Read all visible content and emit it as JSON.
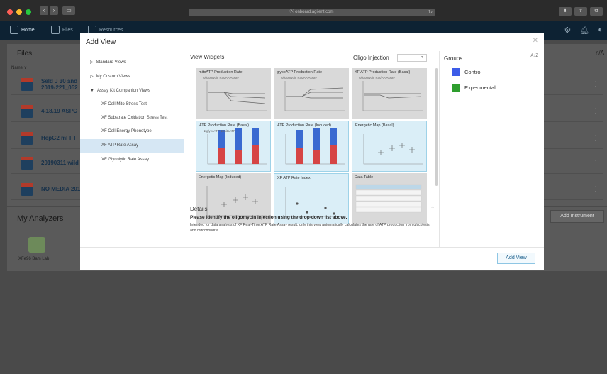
{
  "browser": {
    "url": "Ⓐ onboard.agilent.com",
    "back": "‹",
    "forward": "›",
    "reload": "↻"
  },
  "app_nav": {
    "tabs": [
      {
        "label": "Home",
        "icon": "home-icon"
      },
      {
        "label": "Files",
        "icon": "files-icon"
      },
      {
        "label": "Resources",
        "icon": "resources-icon"
      }
    ]
  },
  "files_panel": {
    "title": "Files",
    "name_header": "Name ∨",
    "rows": [
      {
        "name": "Seld J 30 and\n2019-221_052"
      },
      {
        "name": "4.18.19 ASPC"
      },
      {
        "name": "HepG2 mFFT"
      },
      {
        "name": "20190311 wild"
      },
      {
        "name": "NO MEDIA 201"
      }
    ]
  },
  "analyzers": {
    "title": "My Analyzers",
    "add_button": "Add Instrument",
    "device_label": "XFe96 Bam Lab"
  },
  "modal": {
    "title": "Add View",
    "close": "✕",
    "tree": [
      {
        "label": "Standard Views",
        "expanded": false
      },
      {
        "label": "My Custom Views",
        "expanded": false
      },
      {
        "label": "Assay Kit Companion Views",
        "expanded": true
      }
    ],
    "subitems": [
      "XF Cell Mito Stress Test",
      "XF Substrate Oxidation Stress Test",
      "XF Cell Energy Phenotype",
      "XF ATP Rate Assay",
      "XF Glycolytic Rate Assay"
    ],
    "selected_subitem_index": 3,
    "widgets_title": "View Widgets",
    "oligo_label": "Oligo Injection",
    "oligo_value": "▾",
    "widgets": [
      {
        "title": "mitoATP Production Rate",
        "legend": "Oligomycin  Rot/AA  Assay",
        "kind": "lines-down",
        "selected": false
      },
      {
        "title": "glycoATP Production Rate",
        "legend": "Oligomycin  Rot/AA  Assay",
        "kind": "lines-up",
        "selected": false
      },
      {
        "title": "XF ATP Production Rate (Basal)",
        "legend": "Oligomycin  Rot/AA  Assay",
        "kind": "lines-flat",
        "selected": false
      },
      {
        "title": "ATP Production Rate (Basal)",
        "legend": "■ glycoATP  ■ mitoATP",
        "kind": "bars",
        "selected": true
      },
      {
        "title": "ATP Production Rate (Induced)",
        "legend": "",
        "kind": "bars",
        "selected": true
      },
      {
        "title": "Energetic Map (Basal)",
        "legend": "",
        "kind": "scatter",
        "selected": true
      },
      {
        "title": "Energetic Map (Induced)",
        "legend": "",
        "kind": "scatter",
        "selected": false
      },
      {
        "title": "XF ATP Rate Index",
        "legend": "",
        "kind": "index",
        "selected": true
      },
      {
        "title": "Data Table",
        "legend": "",
        "kind": "table",
        "selected": false
      }
    ],
    "details_title": "Details",
    "details_collapse": "⌃",
    "details_bold": "Please identify the oligomycin injection using the drop-down list above.",
    "details_text": "Intended for data analysis of XF Real-Time ATP Rate Assay result, only this view automatically calculates the rate of ATP production from glycolysis and mitochondria.",
    "groups_title": "Groups",
    "groups_sort": "A↓Z",
    "groups": [
      {
        "label": "Control",
        "color": "#3d5ce8"
      },
      {
        "label": "Experimental",
        "color": "#2e9e2e"
      }
    ],
    "add_button": "Add View"
  },
  "colors": {
    "glyco": "#d64545",
    "mito": "#3a6ad1",
    "nav_bg": "#0d2233"
  }
}
